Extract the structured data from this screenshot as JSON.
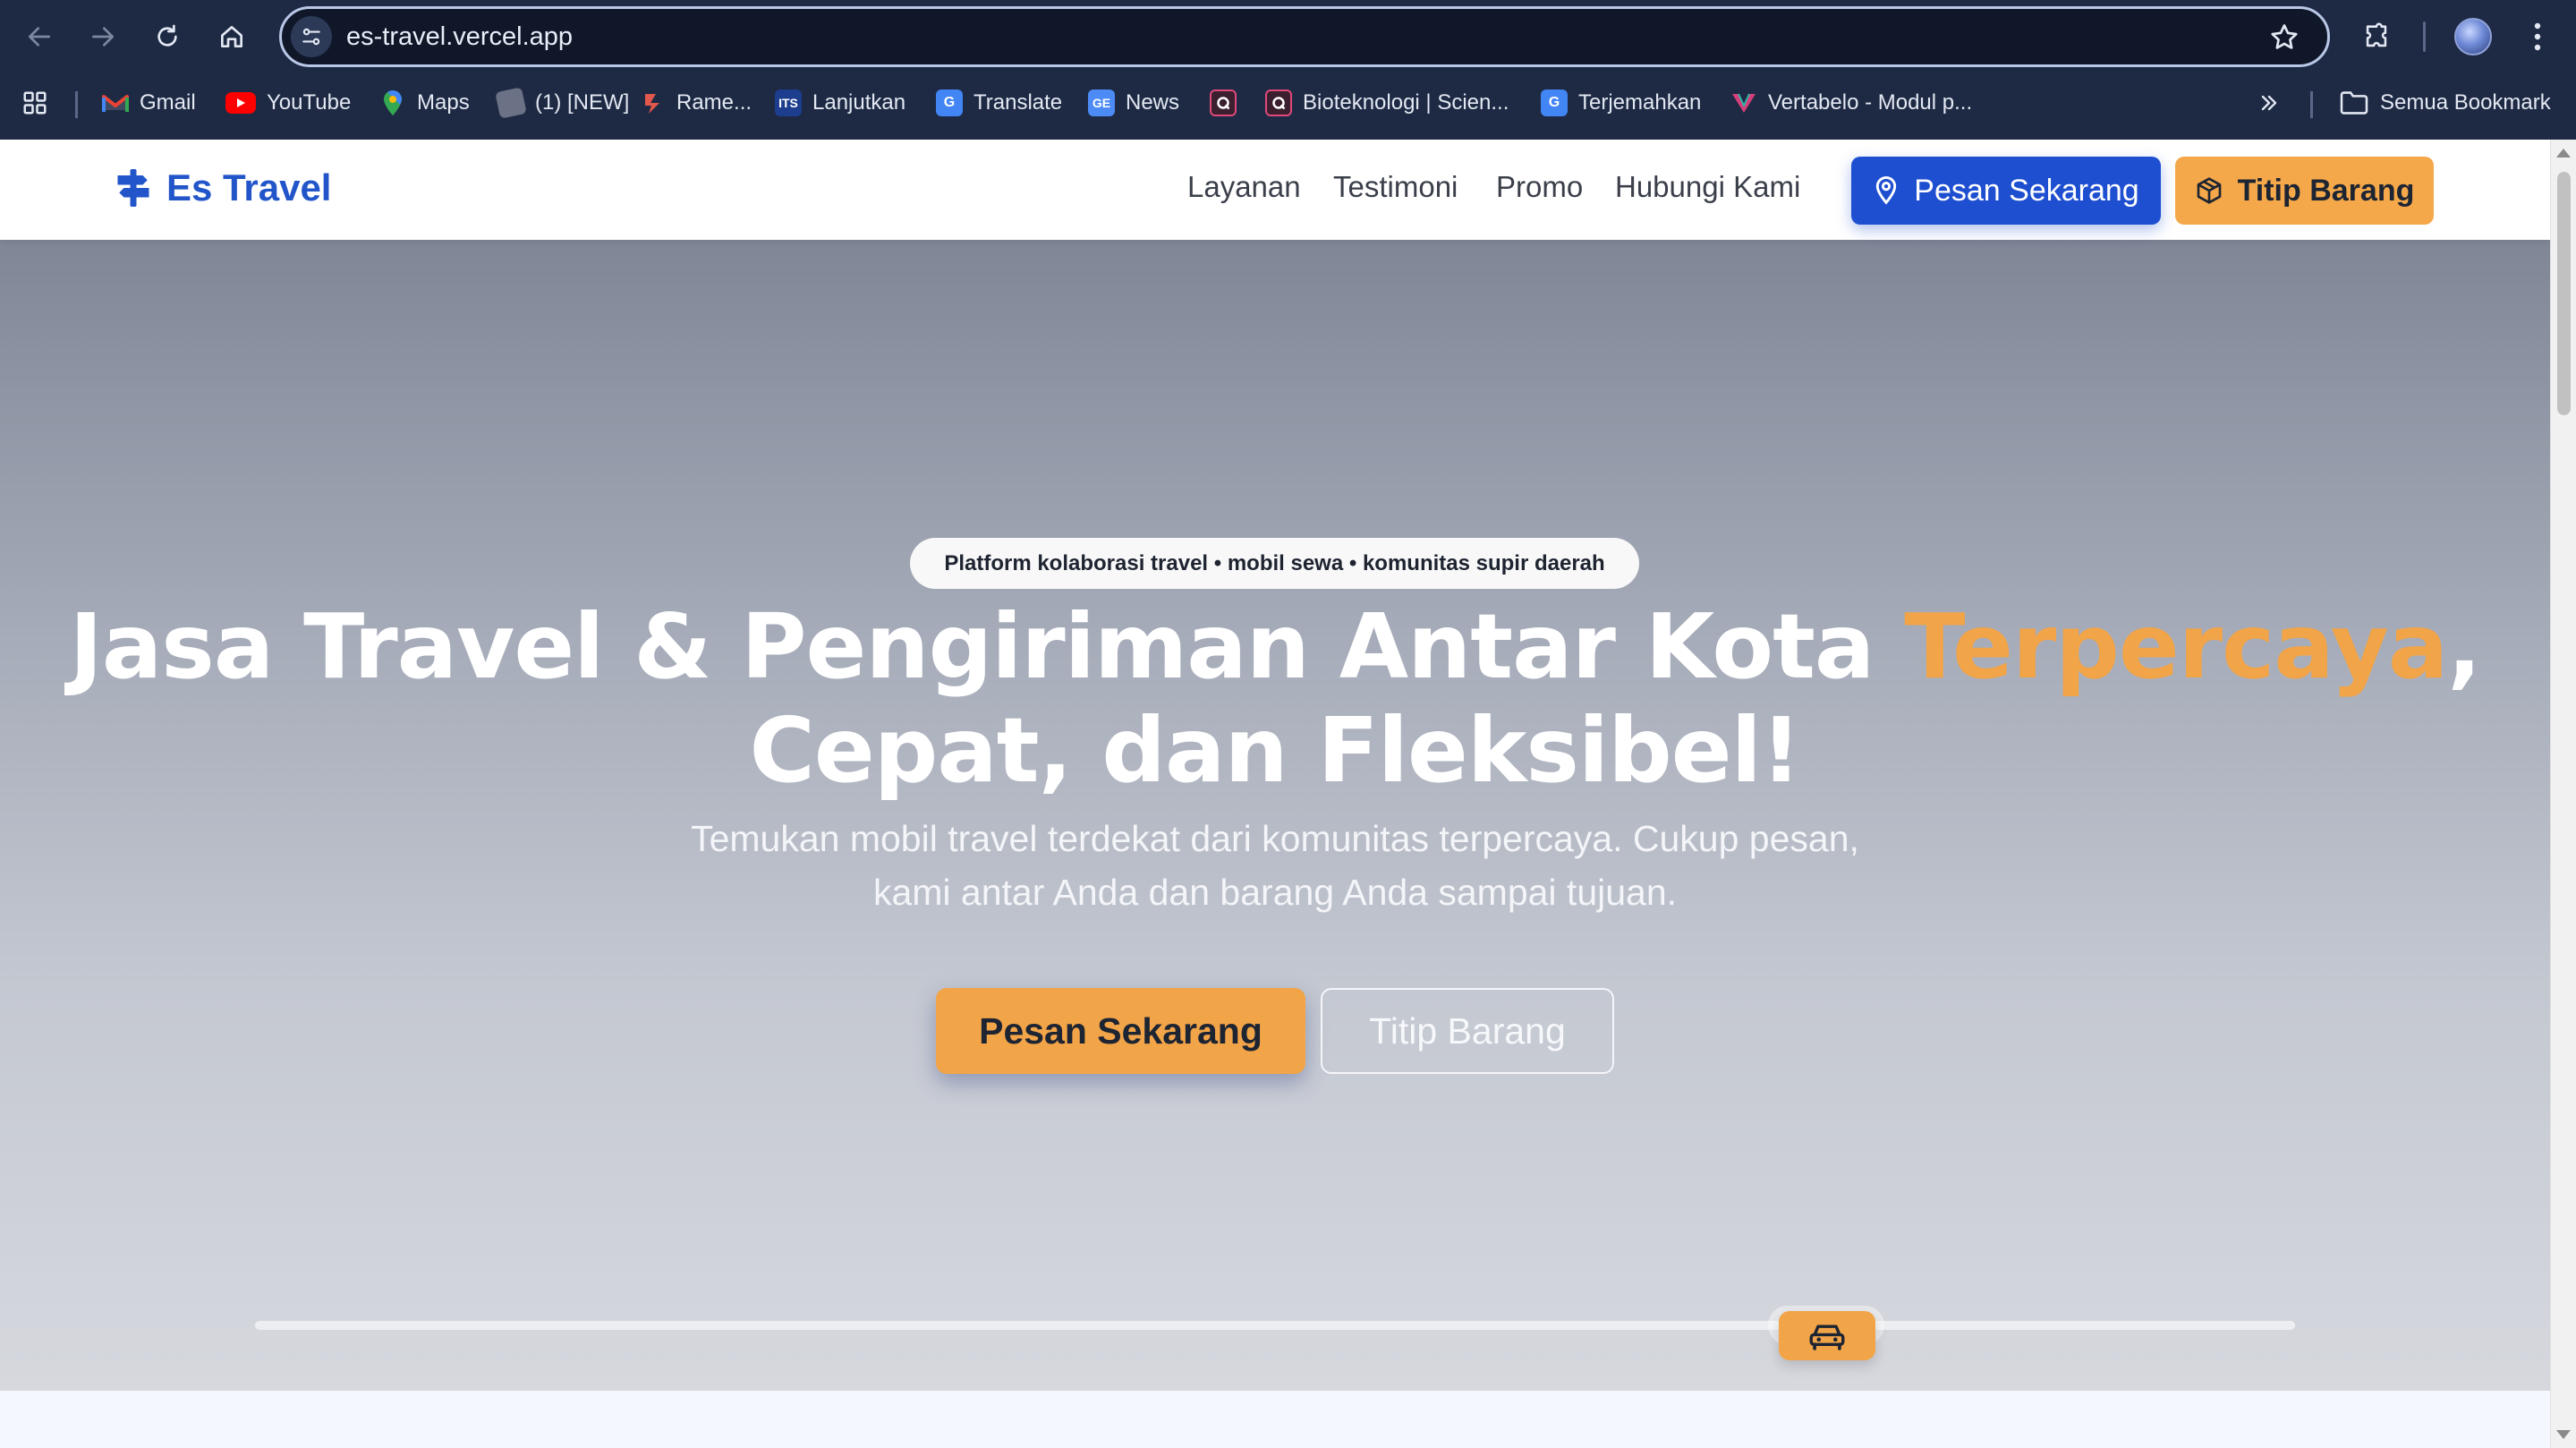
{
  "browser": {
    "url": "es-travel.vercel.app",
    "bookmarks": [
      {
        "label": "Gmail",
        "icon": "gmail-icon"
      },
      {
        "label": "YouTube",
        "icon": "youtube-icon"
      },
      {
        "label": "Maps",
        "icon": "maps-icon"
      },
      {
        "label": "(1) [NEW]",
        "icon": "game-icon"
      },
      {
        "label": "Rame...",
        "icon": "rame-icon"
      },
      {
        "label": "Lanjutkan",
        "icon": "its-icon"
      },
      {
        "label": "Translate",
        "icon": "translate-icon"
      },
      {
        "label": "News",
        "icon": "news-icon"
      },
      {
        "label": "",
        "icon": "quizizz-icon"
      },
      {
        "label": "Bioteknologi | Scien...",
        "icon": "quizizz-icon"
      },
      {
        "label": "Terjemahkan",
        "icon": "translate-icon"
      },
      {
        "label": "Vertabelo - Modul p...",
        "icon": "vertabelo-icon"
      }
    ],
    "all_bookmarks_label": "Semua Bookmark",
    "its_badge": "ITS",
    "news_badge": "GE",
    "translate_badge": "G"
  },
  "site": {
    "brand": "Es Travel",
    "nav": [
      "Layanan",
      "Testimoni",
      "Promo",
      "Hubungi Kami"
    ],
    "header_buttons": {
      "book": "Pesan Sekarang",
      "send": "Titip Barang"
    }
  },
  "hero": {
    "tagline": "Platform kolaborasi travel • mobil sewa • komunitas supir daerah",
    "headline_line1_main": "Jasa Travel & Pengiriman Antar Kota ",
    "headline_line1_accent": "Terpercaya",
    "headline_line1_end": ",",
    "headline_line2": "Cepat, dan Fleksibel!",
    "subtitle_line1": "Temukan mobil travel terdekat dari komunitas terpercaya. Cukup pesan,",
    "subtitle_line2": "kami antar Anda dan barang Anda sampai tujuan.",
    "cta_primary": "Pesan Sekarang",
    "cta_secondary": "Titip Barang",
    "progress": 0.77
  },
  "colors": {
    "brand_blue": "#1f4fd1",
    "accent_orange": "#f2a448"
  }
}
